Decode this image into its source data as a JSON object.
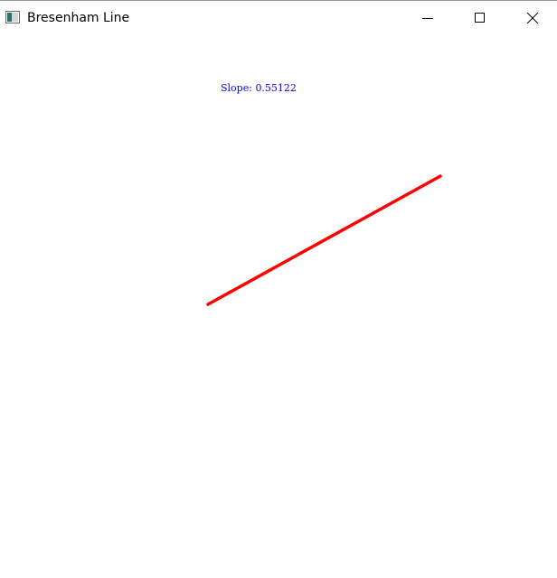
{
  "window": {
    "title": "Bresenham Line",
    "app_icon": "window-app-icon",
    "controls": {
      "minimize_icon": "minimize-icon",
      "maximize_icon": "maximize-icon",
      "close_icon": "close-icon"
    }
  },
  "canvas": {
    "slope_label": "Slope:",
    "slope_value": "0.55122",
    "slope_text_color": "#0000ff",
    "line_color": "#ff0000",
    "background": "#ffffff"
  }
}
